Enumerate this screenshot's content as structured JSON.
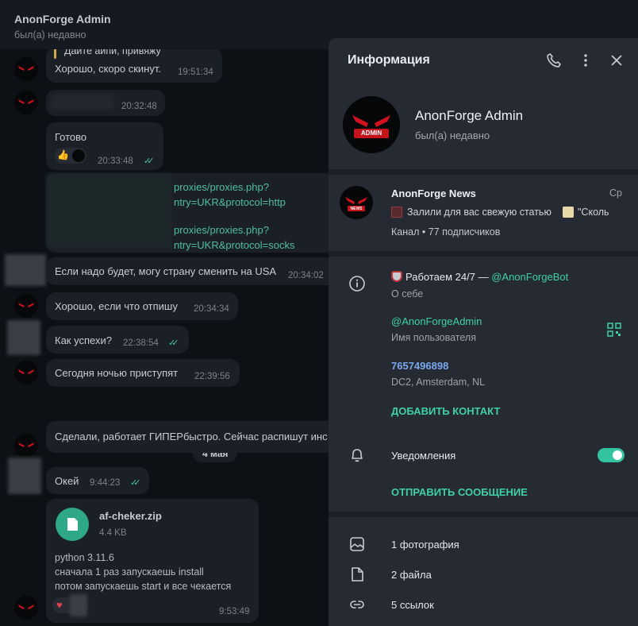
{
  "header": {
    "title": "AnonForge Admin",
    "status": "был(а) недавно"
  },
  "chat": {
    "messages": [
      {
        "quote": "Дайте айпи, привяжу",
        "text": "Хорошо, скоро скинут.",
        "time": "19:51:34"
      },
      {
        "time": "20:32:48"
      },
      {
        "text": "Готово",
        "time": "20:33:48",
        "reaction": "👍"
      },
      {
        "link1a": "proxies/proxies.php?",
        "link1b": "ntry=UKR&protocol=http",
        "link2a": "proxies/proxies.php?",
        "link2b": "ntry=UKR&protocol=socks"
      },
      {
        "text": "Если надо будет, могу страну сменить на USA",
        "time": "20:34:02"
      },
      {
        "text": "Хорошо, если что отпишу",
        "time": "20:34:34"
      },
      {
        "text": "Как успехи?",
        "time": "22:38:54"
      },
      {
        "text": "Сегодня ночью приступят",
        "time": "22:39:56"
      },
      {
        "text": "Сделали, работает ГИПЕРбыстро. Сейчас распишут инс"
      },
      {
        "text": "Окей",
        "time": "9:44:23"
      }
    ],
    "date_separator": "4 мая",
    "file": {
      "name": "af-cheker.zip",
      "size": "4.4 KB",
      "line1": "python 3.11.6",
      "line2": "сначала 1 раз запускаешь install",
      "line3": "потом запускаешь start и все чекается",
      "time": "9:53:49"
    }
  },
  "info": {
    "title": "Информация",
    "profile": {
      "name": "AnonForge Admin",
      "status": "был(а) недавно",
      "avatar_text": "ADMIN"
    },
    "channel": {
      "name": "AnonForge News",
      "day": "Ср",
      "preview": "Залили для вас свежую статью",
      "preview_tail": "\"Сколь",
      "meta": "Канал • 77 подписчиков",
      "avatar_text": "NEWS"
    },
    "bio": {
      "text_prefix": "Работаем 24/7 — ",
      "bot": "@AnonForgeBot",
      "label": "О себе"
    },
    "username": {
      "value": "@AnonForgeAdmin",
      "label": "Имя пользователя"
    },
    "phone": {
      "value": "7657496898",
      "label": "DC2, Amsterdam, NL"
    },
    "add_contact": "ДОБАВИТЬ КОНТАКТ",
    "notifications": {
      "label": "Уведомления",
      "enabled": true
    },
    "send_message": "ОТПРАВИТЬ СООБЩЕНИЕ",
    "media": {
      "photos": "1 фотография",
      "files": "2 файла",
      "links": "5 ссылок"
    }
  },
  "colors": {
    "accent": "#3fd0a8",
    "phone": "#7aa8ee",
    "panel_bg": "#262a33",
    "chat_bg": "#0d1015"
  }
}
